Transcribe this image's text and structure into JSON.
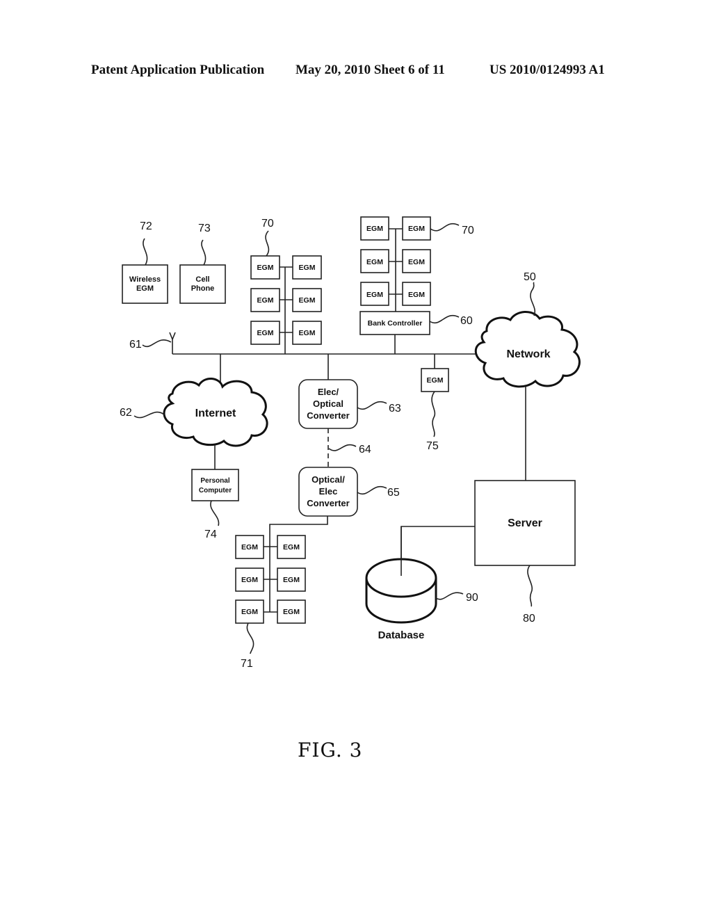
{
  "header": {
    "publication": "Patent Application Publication",
    "date_sheet": "May 20, 2010  Sheet 6 of 11",
    "number": "US 2010/0124993 A1"
  },
  "figure_label": "FIG. 3",
  "nodes": {
    "wireless_egm": {
      "line1": "Wireless",
      "line2": "EGM",
      "ref": "72"
    },
    "cell_phone": {
      "line1": "Cell",
      "line2": "Phone",
      "ref": "73"
    },
    "egm_bank_left": {
      "label": "EGM",
      "ref": "70"
    },
    "egm_bank_right": {
      "label": "EGM",
      "ref": "70"
    },
    "bank_controller": {
      "label": "Bank Controller",
      "ref": "60"
    },
    "antenna": {
      "ref": "61"
    },
    "network": {
      "label": "Network",
      "ref": "50"
    },
    "internet": {
      "label": "Internet",
      "ref": "62"
    },
    "elec_optical": {
      "line1": "Elec/",
      "line2": "Optical",
      "line3": "Converter",
      "ref": "63"
    },
    "fiber_link": {
      "ref": "64"
    },
    "optical_elec": {
      "line1": "Optical/",
      "line2": "Elec",
      "line3": "Converter",
      "ref": "65"
    },
    "single_egm": {
      "label": "EGM",
      "ref": "75"
    },
    "personal_computer": {
      "line1": "Personal",
      "line2": "Computer",
      "ref": "74"
    },
    "egm_bank_bottom": {
      "label": "EGM",
      "ref": "71"
    },
    "server": {
      "label": "Server",
      "ref": "80"
    },
    "database": {
      "label": "Database",
      "ref": "90"
    }
  }
}
